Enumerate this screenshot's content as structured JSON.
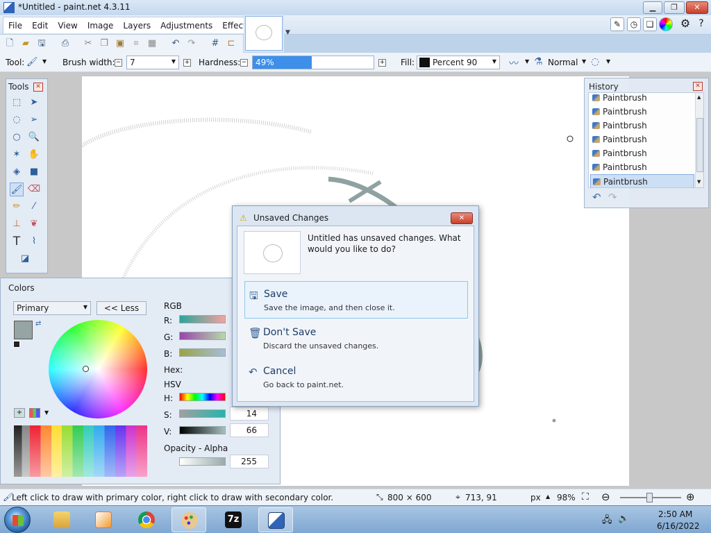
{
  "window": {
    "title": "*Untitled - paint.net 4.3.11",
    "min": "▁",
    "max": "❐",
    "close": "✕"
  },
  "menu": [
    "File",
    "Edit",
    "View",
    "Image",
    "Layers",
    "Adjustments",
    "Effects"
  ],
  "toolbar": {
    "tool_label": "Tool:",
    "brush_width_label": "Brush width:",
    "brush_width_value": "7",
    "hardness_label": "Hardness:",
    "hardness_value": "49%",
    "hardness_fraction": 0.49,
    "fill_label": "Fill:",
    "fill_value": "Percent 90",
    "blend_mode": "Normal"
  },
  "tools_panel": {
    "title": "Tools"
  },
  "history_panel": {
    "title": "History",
    "items": [
      "Paintbrush",
      "Paintbrush",
      "Paintbrush",
      "Paintbrush",
      "Paintbrush",
      "Paintbrush",
      "Paintbrush"
    ],
    "selected_index": 6
  },
  "colors_panel": {
    "title": "Colors",
    "selector": "Primary",
    "less_button": "<< Less",
    "rgb_label": "RGB",
    "r_label": "R:",
    "g_label": "G:",
    "b_label": "B:",
    "hex_label": "Hex:",
    "hsv_label": "HSV",
    "h_label": "H:",
    "s_label": "S:",
    "v_label": "V:",
    "s_value": "14",
    "v_value": "66",
    "opacity_label": "Opacity - Alpha",
    "alpha_value": "255",
    "primary_color": "#96a5a4"
  },
  "dialog": {
    "title": "Unsaved Changes",
    "message": "Untitled has unsaved changes. What would you like to do?",
    "options": [
      {
        "title": "Save",
        "desc": "Save the image, and then close it."
      },
      {
        "title": "Don't Save",
        "desc": "Discard the unsaved changes."
      },
      {
        "title": "Cancel",
        "desc": "Go back to paint.net."
      }
    ]
  },
  "statusbar": {
    "hint": "Left click to draw with primary color, right click to draw with secondary color.",
    "image_size": "800 × 600",
    "cursor_pos": "713, 91",
    "units": "px",
    "zoom": "98%"
  },
  "taskbar": {
    "time": "2:50 AM",
    "date": "6/16/2022",
    "apps": [
      "start",
      "explorer",
      "media-player",
      "chrome",
      "paint-net",
      "7zip",
      "paint-net-doc"
    ]
  }
}
